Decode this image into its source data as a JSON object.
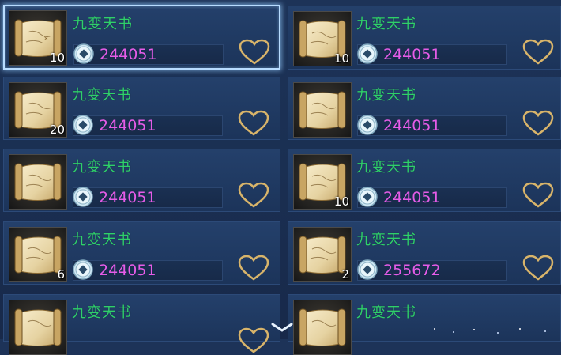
{
  "items": [
    {
      "name": "九变天书",
      "count": "10",
      "price": "244051",
      "selected": true
    },
    {
      "name": "九变天书",
      "count": "10",
      "price": "244051",
      "selected": false
    },
    {
      "name": "九变天书",
      "count": "20",
      "price": "244051",
      "selected": false
    },
    {
      "name": "九变天书",
      "count": "",
      "price": "244051",
      "selected": false
    },
    {
      "name": "九变天书",
      "count": "",
      "price": "244051",
      "selected": false
    },
    {
      "name": "九变天书",
      "count": "10",
      "price": "244051",
      "selected": false
    },
    {
      "name": "九变天书",
      "count": "6",
      "price": "244051",
      "selected": false
    },
    {
      "name": "九变天书",
      "count": "2",
      "price": "255672",
      "selected": false
    },
    {
      "name": "九变天书",
      "count": "",
      "price": "",
      "selected": false
    },
    {
      "name": "九变天书",
      "count": "",
      "price": "",
      "selected": false
    }
  ],
  "icons": {
    "item": "scroll-map-icon",
    "currency": "coin-icon",
    "favorite": "heart-outline-icon",
    "scroll_more": "chevron-down-icon"
  },
  "colors": {
    "name": "#2fd06a",
    "price": "#e65ce8",
    "heart": "#d8b46a",
    "selected_border": "#b8dcff"
  }
}
